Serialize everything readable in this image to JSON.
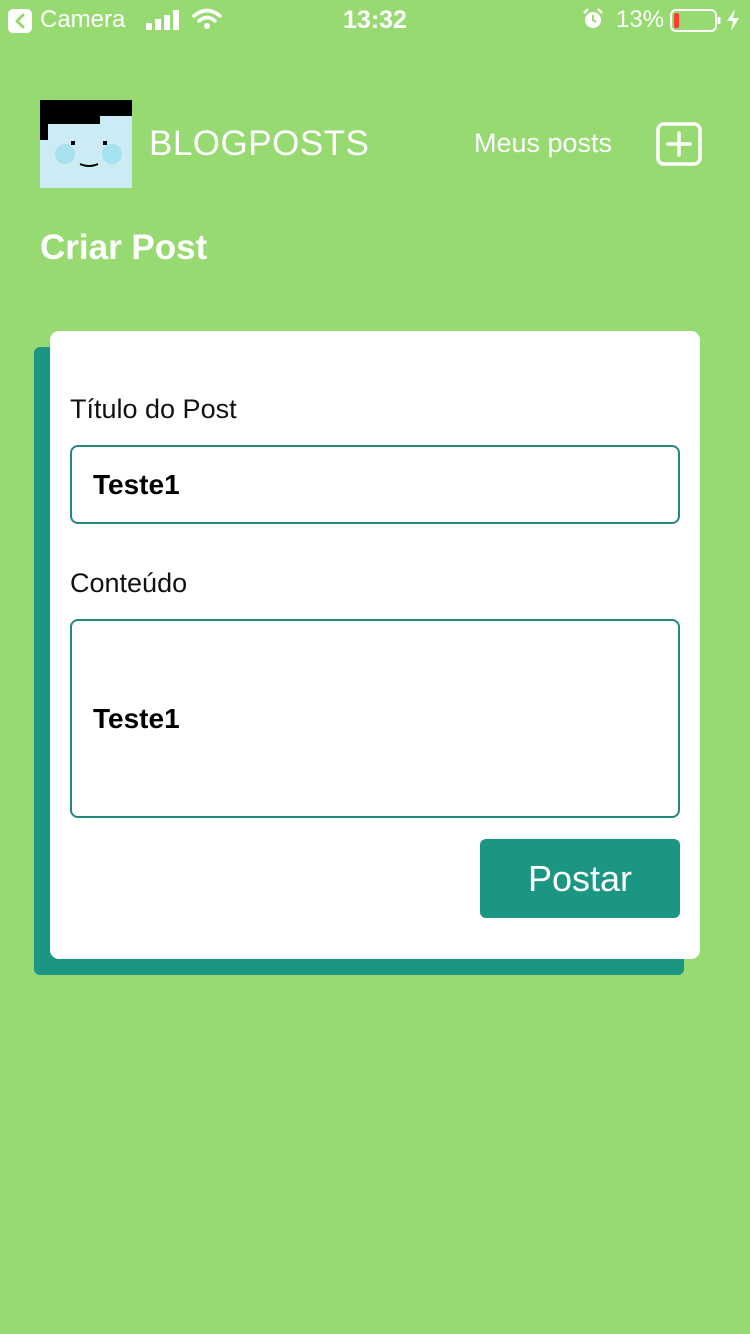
{
  "status_bar": {
    "back_app": "Camera",
    "time": "13:32",
    "battery_percent": "13%",
    "battery_level": 0.13,
    "battery_color": "#ff3b30"
  },
  "header": {
    "brand": "BLOGPOSTS",
    "my_posts_label": "Meus posts",
    "add_icon": "plus-square-icon"
  },
  "page": {
    "title": "Criar Post"
  },
  "form": {
    "title_label": "Título do Post",
    "title_value": "Teste1",
    "content_label": "Conteúdo",
    "content_value": "Teste1",
    "submit_label": "Postar"
  },
  "colors": {
    "background": "#97da71",
    "accent": "#1a9683",
    "field_border": "#27877e"
  }
}
